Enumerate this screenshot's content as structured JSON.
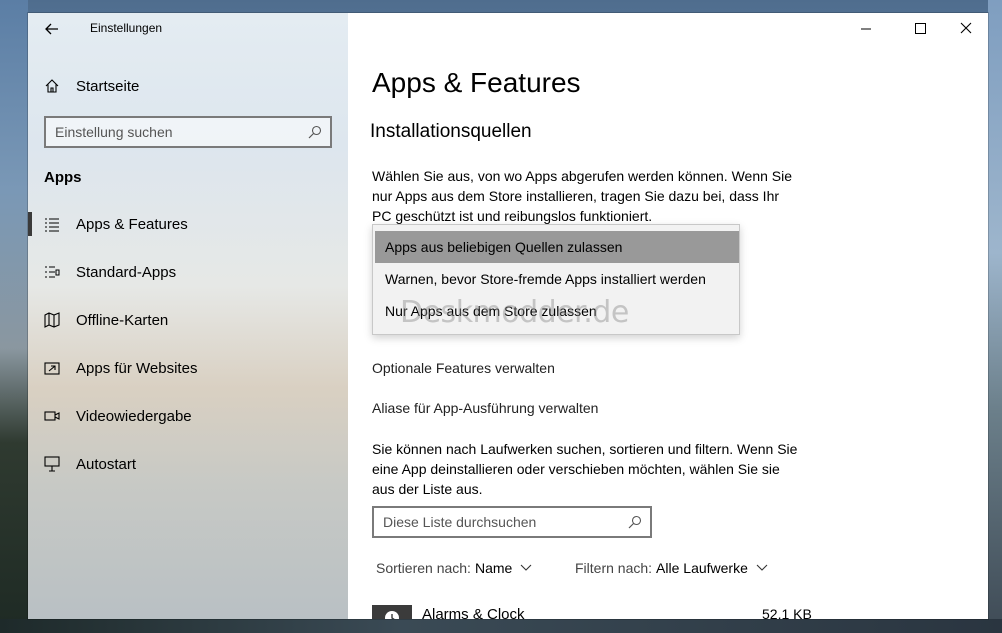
{
  "window": {
    "app_title": "Einstellungen",
    "accent_color": "#999999"
  },
  "sidebar": {
    "home_label": "Startseite",
    "search_placeholder": "Einstellung suchen",
    "section": "Apps",
    "items": [
      {
        "label": "Apps & Features",
        "icon": "list-icon",
        "active": true
      },
      {
        "label": "Standard-Apps",
        "icon": "list-default-icon",
        "active": false
      },
      {
        "label": "Offline-Karten",
        "icon": "map-icon",
        "active": false
      },
      {
        "label": "Apps für Websites",
        "icon": "external-link-icon",
        "active": false
      },
      {
        "label": "Videowiedergabe",
        "icon": "video-icon",
        "active": false
      },
      {
        "label": "Autostart",
        "icon": "startup-icon",
        "active": false
      }
    ]
  },
  "main": {
    "title": "Apps & Features",
    "subtitle": "Installationsquellen",
    "source_desc_lines": [
      "Wählen Sie aus, von wo Apps abgerufen werden können. Wenn Sie",
      "nur Apps aus dem Store installieren, tragen Sie dazu bei, dass Ihr",
      "PC geschützt ist und reibungslos funktioniert."
    ],
    "dropdown_options": [
      {
        "label": "Apps aus beliebigen Quellen zulassen",
        "selected": true
      },
      {
        "label": "Warnen, bevor Store-fremde Apps installiert werden",
        "selected": false
      },
      {
        "label": "Nur Apps aus dem Store zulassen",
        "selected": false
      }
    ],
    "watermark": "Deskmodder.de",
    "optional_features": "Optionale Features verwalten",
    "alias": "Aliase für App-Ausführung verwalten",
    "list_desc_lines": [
      "Sie können nach Laufwerken suchen, sortieren und filtern. Wenn Sie",
      "eine App deinstallieren oder verschieben möchten, wählen Sie sie",
      "aus der Liste aus."
    ],
    "list_search_placeholder": "Diese Liste durchsuchen",
    "sort_label": "Sortieren nach:",
    "sort_value": "Name",
    "filter_label": "Filtern nach:",
    "filter_value": "Alle Laufwerke",
    "apps": [
      {
        "name": "Alarms & Clock",
        "size": "52,1 KB"
      }
    ]
  }
}
